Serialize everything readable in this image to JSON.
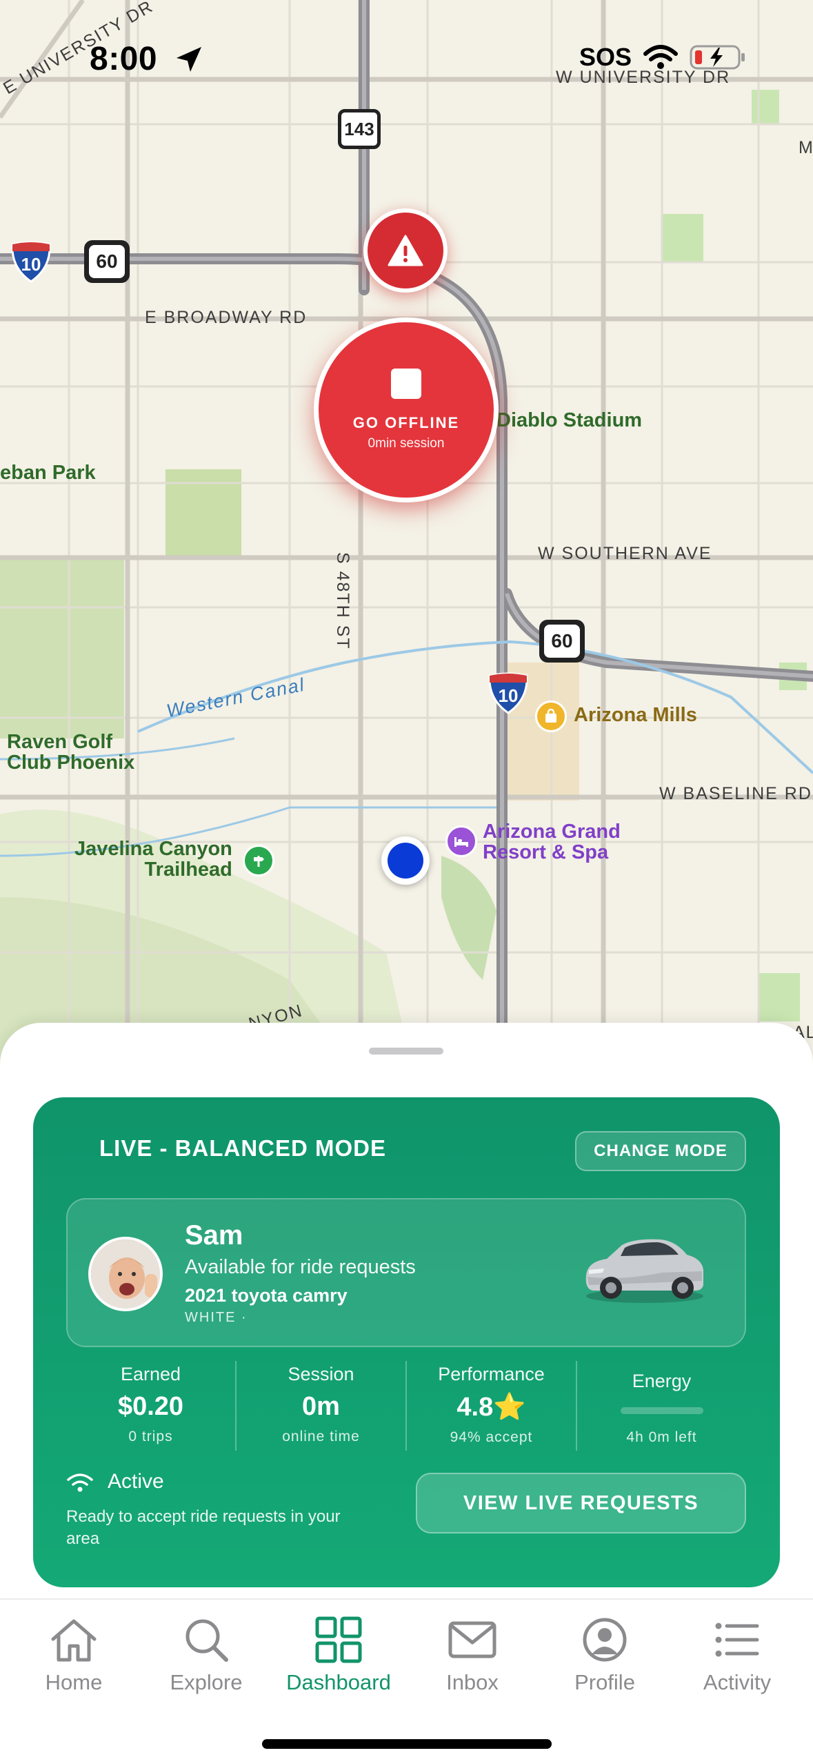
{
  "status_bar": {
    "time": "8:00",
    "sos": "SOS"
  },
  "map": {
    "streets": {
      "university_left": "E UNIVERSITY DR",
      "university_right": "W UNIVERSITY DR",
      "broadway": "E BROADWAY RD",
      "southern": "W SOUTHERN AVE",
      "baseline": "W BASELINE RD",
      "s48th": "S 48TH ST",
      "canyon": "NYON",
      "edge_m": "M",
      "edge_al": "AL"
    },
    "pois": {
      "diablo": "Diablo Stadium",
      "park": "eban Park",
      "raven": "Raven Golf\nClub Phoenix",
      "canal": "Western Canal",
      "arizona_mills": "Arizona Mills",
      "javelina": "Javelina Canyon\nTrailhead",
      "resort": "Arizona Grand\nResort & Spa"
    },
    "shields": {
      "sr143": "143",
      "us60_a": "60",
      "us60_b": "60",
      "i10_a": "10",
      "i10_b": "10"
    },
    "go_offline": {
      "label": "GO OFFLINE",
      "session": "0min session"
    }
  },
  "card": {
    "mode_title": "LIVE - BALANCED MODE",
    "change_mode": "CHANGE MODE",
    "driver": {
      "name": "Sam",
      "status": "Available for ride requests",
      "car": "2021 toyota camry",
      "color": "WHITE  ·"
    },
    "stats": [
      {
        "label": "Earned",
        "value": "$0.20",
        "sub": "0 trips"
      },
      {
        "label": "Session",
        "value": "0m",
        "sub": "online time"
      },
      {
        "label": "Performance",
        "value": "4.8⭐",
        "sub": "94% accept"
      },
      {
        "label": "Energy",
        "sub": "4h 0m left",
        "level": 0
      }
    ],
    "active_title": "Active",
    "active_desc": "Ready to accept ride requests in your area",
    "view_requests": "VIEW LIVE REQUESTS"
  },
  "tabs": [
    {
      "label": "Home",
      "icon": "home-icon"
    },
    {
      "label": "Explore",
      "icon": "search-icon"
    },
    {
      "label": "Dashboard",
      "icon": "grid-icon",
      "active": true
    },
    {
      "label": "Inbox",
      "icon": "mail-icon"
    },
    {
      "label": "Profile",
      "icon": "person-icon"
    },
    {
      "label": "Activity",
      "icon": "list-icon"
    }
  ],
  "colors": {
    "accent": "#12946a",
    "danger": "#e4353c",
    "user_dot": "#0a3bd6"
  }
}
